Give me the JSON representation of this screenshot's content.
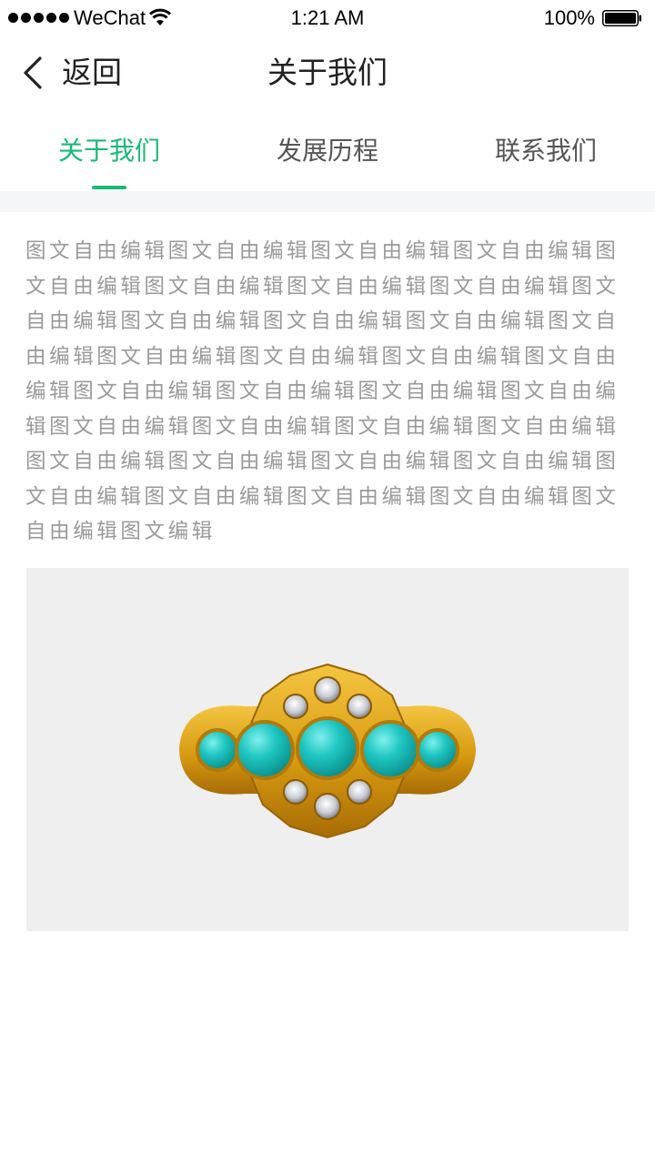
{
  "status_bar": {
    "carrier": "WeChat",
    "time": "1:21 AM",
    "battery_percent": "100%",
    "signal_icon": "signal-dots-icon",
    "wifi_icon": "wifi-icon",
    "battery_icon": "battery-icon"
  },
  "nav": {
    "back_label": "返回",
    "title": "关于我们",
    "back_icon": "chevron-left-icon"
  },
  "tabs": [
    {
      "label": "关于我们",
      "active": true
    },
    {
      "label": "发展历程",
      "active": false
    },
    {
      "label": "联系我们",
      "active": false
    }
  ],
  "content": {
    "body_text": "图文自由编辑图文自由编辑图文自由编辑图文自由编辑图文自由编辑图文自由编辑图文自由编辑图文自由编辑图文自由编辑图文自由编辑图文自由编辑图文自由编辑图文自由编辑图文自由编辑图文自由编辑图文自由编辑图文自由编辑图文自由编辑图文自由编辑图文自由编辑图文自由编辑图文自由编辑图文自由编辑图文自由编辑图文自由编辑图文自由编辑图文自由编辑图文自由编辑图文自由编辑图文自由编辑图文自由编辑图文自由编辑图文自由编辑图文自由编辑图文编辑",
    "image": "turquoise-ring-photo"
  },
  "colors": {
    "accent": "#1ab976",
    "tab_inactive": "#555555",
    "body_text": "#999999",
    "image_bg": "#efefef",
    "band": "#f5f6f8"
  }
}
